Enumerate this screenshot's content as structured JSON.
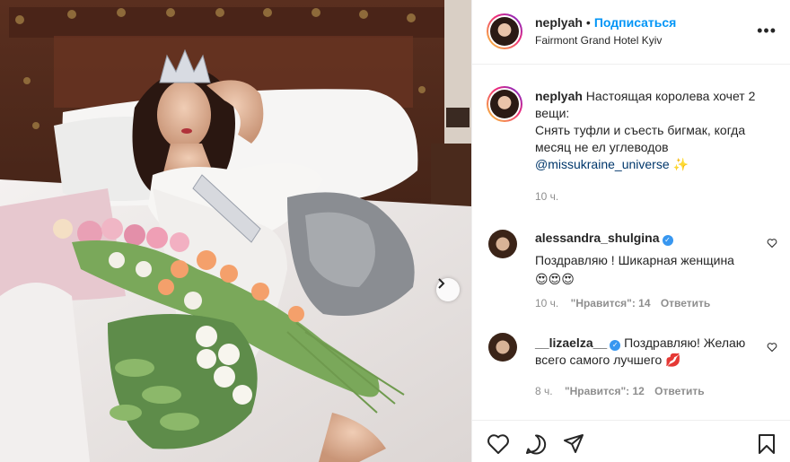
{
  "post": {
    "username": "neplyah",
    "separator": "•",
    "follow_label": "Подписаться",
    "location": "Fairmont Grand Hotel Kyiv",
    "more_label": "•••"
  },
  "caption": {
    "username": "neplyah",
    "text": "Настоящая королева хочет 2 вещи: Снять туфли и съесть бигмак, когда месяц не ел углеводов",
    "line1": "Настоящая королева хочет 2",
    "line2": "вещи:",
    "line3": "Снять туфли и съесть бигмак, когда",
    "line4": "месяц не ел углеводов",
    "mention": "@missukraine_universe",
    "emoji": "✨",
    "time": "10 ч."
  },
  "comments": [
    {
      "username": "alessandra_shulgina",
      "verified": true,
      "text": "Поздравляю ! Шикарная женщина",
      "emoji": "😍😍😍",
      "time": "10 ч.",
      "likes": "\"Нравится\": 14",
      "reply": "Ответить"
    },
    {
      "username": "__lizaelza__",
      "verified": true,
      "text_line1": "Поздравляю! Желаю",
      "text_line2": "всего самого лучшего",
      "emoji": "💋",
      "time": "8 ч.",
      "likes": "\"Нравится\": 12",
      "reply": "Ответить"
    }
  ],
  "icons": {
    "like": "heart-icon",
    "comment": "comment-icon",
    "share": "share-icon",
    "save": "bookmark-icon",
    "next": "chevron-right-icon"
  },
  "colors": {
    "link": "#0095f6",
    "mention": "#00376b",
    "verified": "#3897f0",
    "muted": "#8e8e8e"
  }
}
